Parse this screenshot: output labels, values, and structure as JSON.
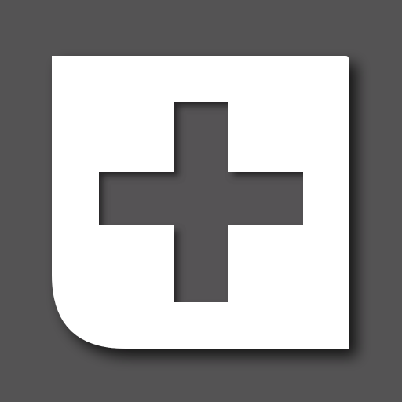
{
  "icon": {
    "name": "add-plus-icon",
    "tile_color": "#FFFFFF",
    "cross_color": "#545354",
    "background_color": "#545354"
  }
}
